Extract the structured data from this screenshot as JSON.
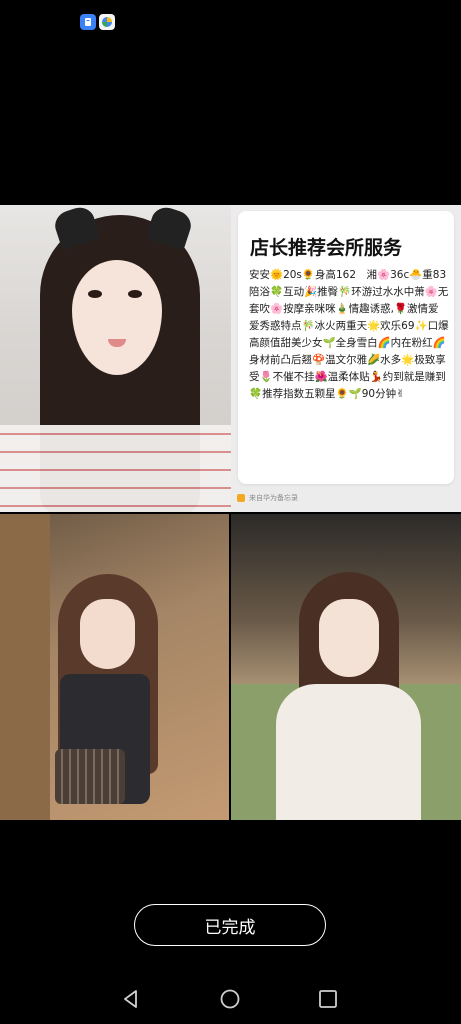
{
  "status_bar": {
    "icons": [
      "notification-app-icon",
      "browser-app-icon"
    ]
  },
  "card": {
    "title": "店长推荐会所服务",
    "body": "安安🌞20s🌻身高162　湘🌸36c🐣重83陪浴🍀互动🎉推臀🎋环游过水水中萧🌸无套吹🌸按摩亲咪咪🎍情趣诱惑,🌹激情爱爱秀惑特点🎋冰火两重天🌟欢乐69✨口爆高颜值甜美少女🌱全身雪白🌈内在粉红🌈身材前凸后翘🍄温文尔雅🌽水多🌟极致享受🌷不催不挂🌺温柔体贴💃约到就是赚到🍀推荐指数五颗星🌻🌱90分钟✌",
    "source": "来自华为备忘录"
  },
  "actions": {
    "done_label": "已完成"
  },
  "nav": {
    "back": "back-icon",
    "home": "home-icon",
    "recent": "recent-apps-icon"
  },
  "colors": {
    "background": "#000000",
    "card": "#ffffff",
    "button_border": "#ffffff"
  }
}
